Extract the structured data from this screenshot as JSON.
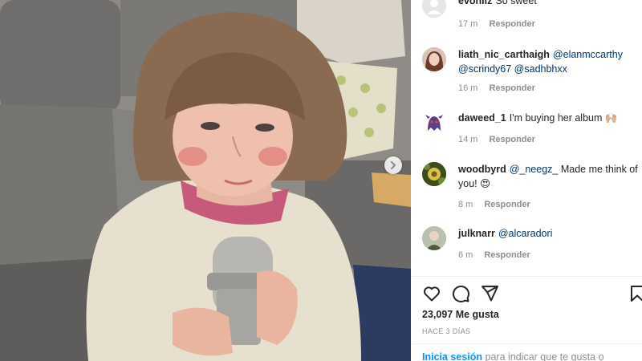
{
  "post": {
    "image_alt": "Girl holding a microphone",
    "carousel_next": "next-arrow"
  },
  "comments": [
    {
      "user": "evonliz",
      "text": "So sweet",
      "mentions": [],
      "time": "17 m",
      "reply": "Responder"
    },
    {
      "user": "liath_nic_carthaigh",
      "text": "",
      "mentions": [
        "@elanmccarthy",
        "@scrindy67",
        "@sadhbhxx"
      ],
      "time": "16 m",
      "reply": "Responder"
    },
    {
      "user": "daweed_1",
      "text": "I'm buying her album 🙌🏼",
      "mentions": [],
      "time": "14 m",
      "reply": "Responder"
    },
    {
      "user": "woodbyrd",
      "pre_text": "",
      "mention": "@_neegz_",
      "text": " Made me think of you! 😍",
      "time": "8 m",
      "reply": "Responder"
    },
    {
      "user": "julknarr",
      "mentions": [
        "@alcaradori"
      ],
      "text": "",
      "time": "6 m",
      "reply": "Responder"
    }
  ],
  "stats": {
    "likes": "23,097 Me gusta",
    "posted": "HACE 3 DÍAS"
  },
  "login": {
    "link": "Inicia sesión",
    "text": " para indicar que te gusta o"
  },
  "icons": [
    "heart-icon",
    "comment-icon",
    "share-icon",
    "bookmark-icon"
  ]
}
